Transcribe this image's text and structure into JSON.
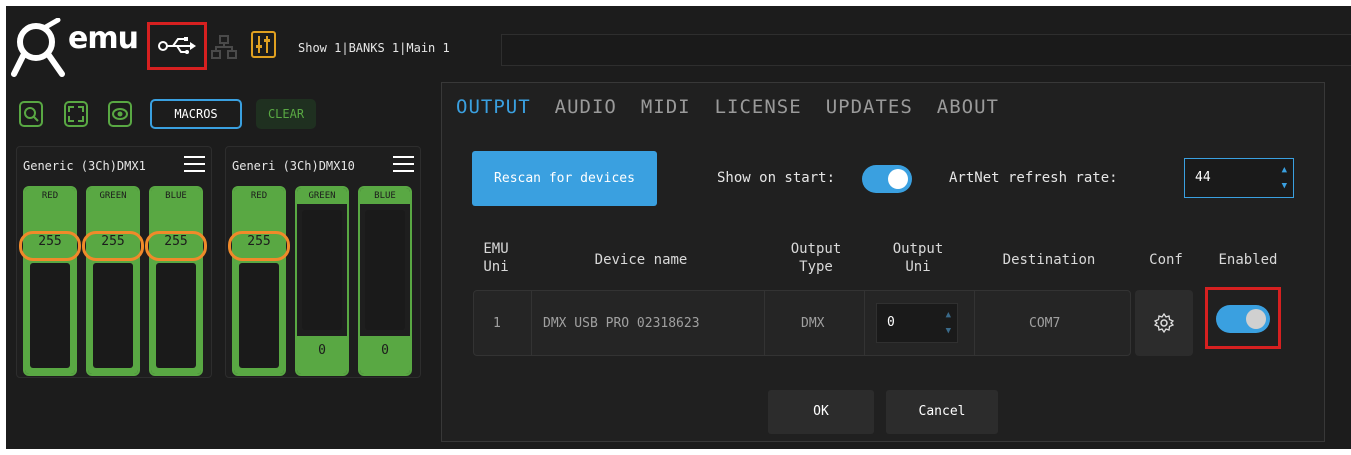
{
  "topbar": {
    "logo_text": "emu",
    "path": "Show 1|BANKS 1|Main 1",
    "icons": [
      "emu-logo-icon",
      "usb-icon",
      "network-icon",
      "mixer-icon"
    ]
  },
  "toolbar": {
    "icons": [
      "search-icon",
      "fullscreen-icon",
      "eye-icon"
    ],
    "macros_label": "MACROS",
    "clear_label": "CLEAR"
  },
  "fixtures": [
    {
      "title": "Generic (3Ch)DMX1",
      "channels": [
        {
          "label": "RED",
          "value": "255",
          "level": 1.0
        },
        {
          "label": "GREEN",
          "value": "255",
          "level": 1.0
        },
        {
          "label": "BLUE",
          "value": "255",
          "level": 1.0
        }
      ]
    },
    {
      "title": "Generi (3Ch)DMX10",
      "channels": [
        {
          "label": "RED",
          "value": "255",
          "level": 1.0
        },
        {
          "label": "GREEN",
          "value": "0",
          "level": 0.0
        },
        {
          "label": "BLUE",
          "value": "0",
          "level": 0.0
        }
      ]
    }
  ],
  "dialog": {
    "tabs": [
      "OUTPUT",
      "AUDIO",
      "MIDI",
      "LICENSE",
      "UPDATES",
      "ABOUT"
    ],
    "active_tab": "OUTPUT",
    "rescan_label": "Rescan for devices",
    "show_on_start_label": "Show on start:",
    "show_on_start": true,
    "artnet_label": "ArtNet refresh rate:",
    "artnet_value": "44",
    "table": {
      "headers": {
        "emu_uni": [
          "EMU",
          "Uni"
        ],
        "device_name": "Device name",
        "output_type": [
          "Output",
          "Type"
        ],
        "output_uni": [
          "Output",
          "Uni"
        ],
        "destination": "Destination",
        "conf": "Conf",
        "enabled": "Enabled"
      },
      "rows": [
        {
          "emu_uni": "1",
          "device_name": "DMX USB PRO 02318623",
          "output_type": "DMX",
          "output_uni": "0",
          "destination": "COM7",
          "enabled": true
        }
      ]
    },
    "ok_label": "OK",
    "cancel_label": "Cancel"
  },
  "colors": {
    "background": "#1c1c1c",
    "accent_blue": "#3aa0e0",
    "fader_green": "#59a843",
    "highlight_red": "#d62020",
    "highlight_orange": "#f08a2a",
    "mixer_yellow": "#e0a020"
  }
}
